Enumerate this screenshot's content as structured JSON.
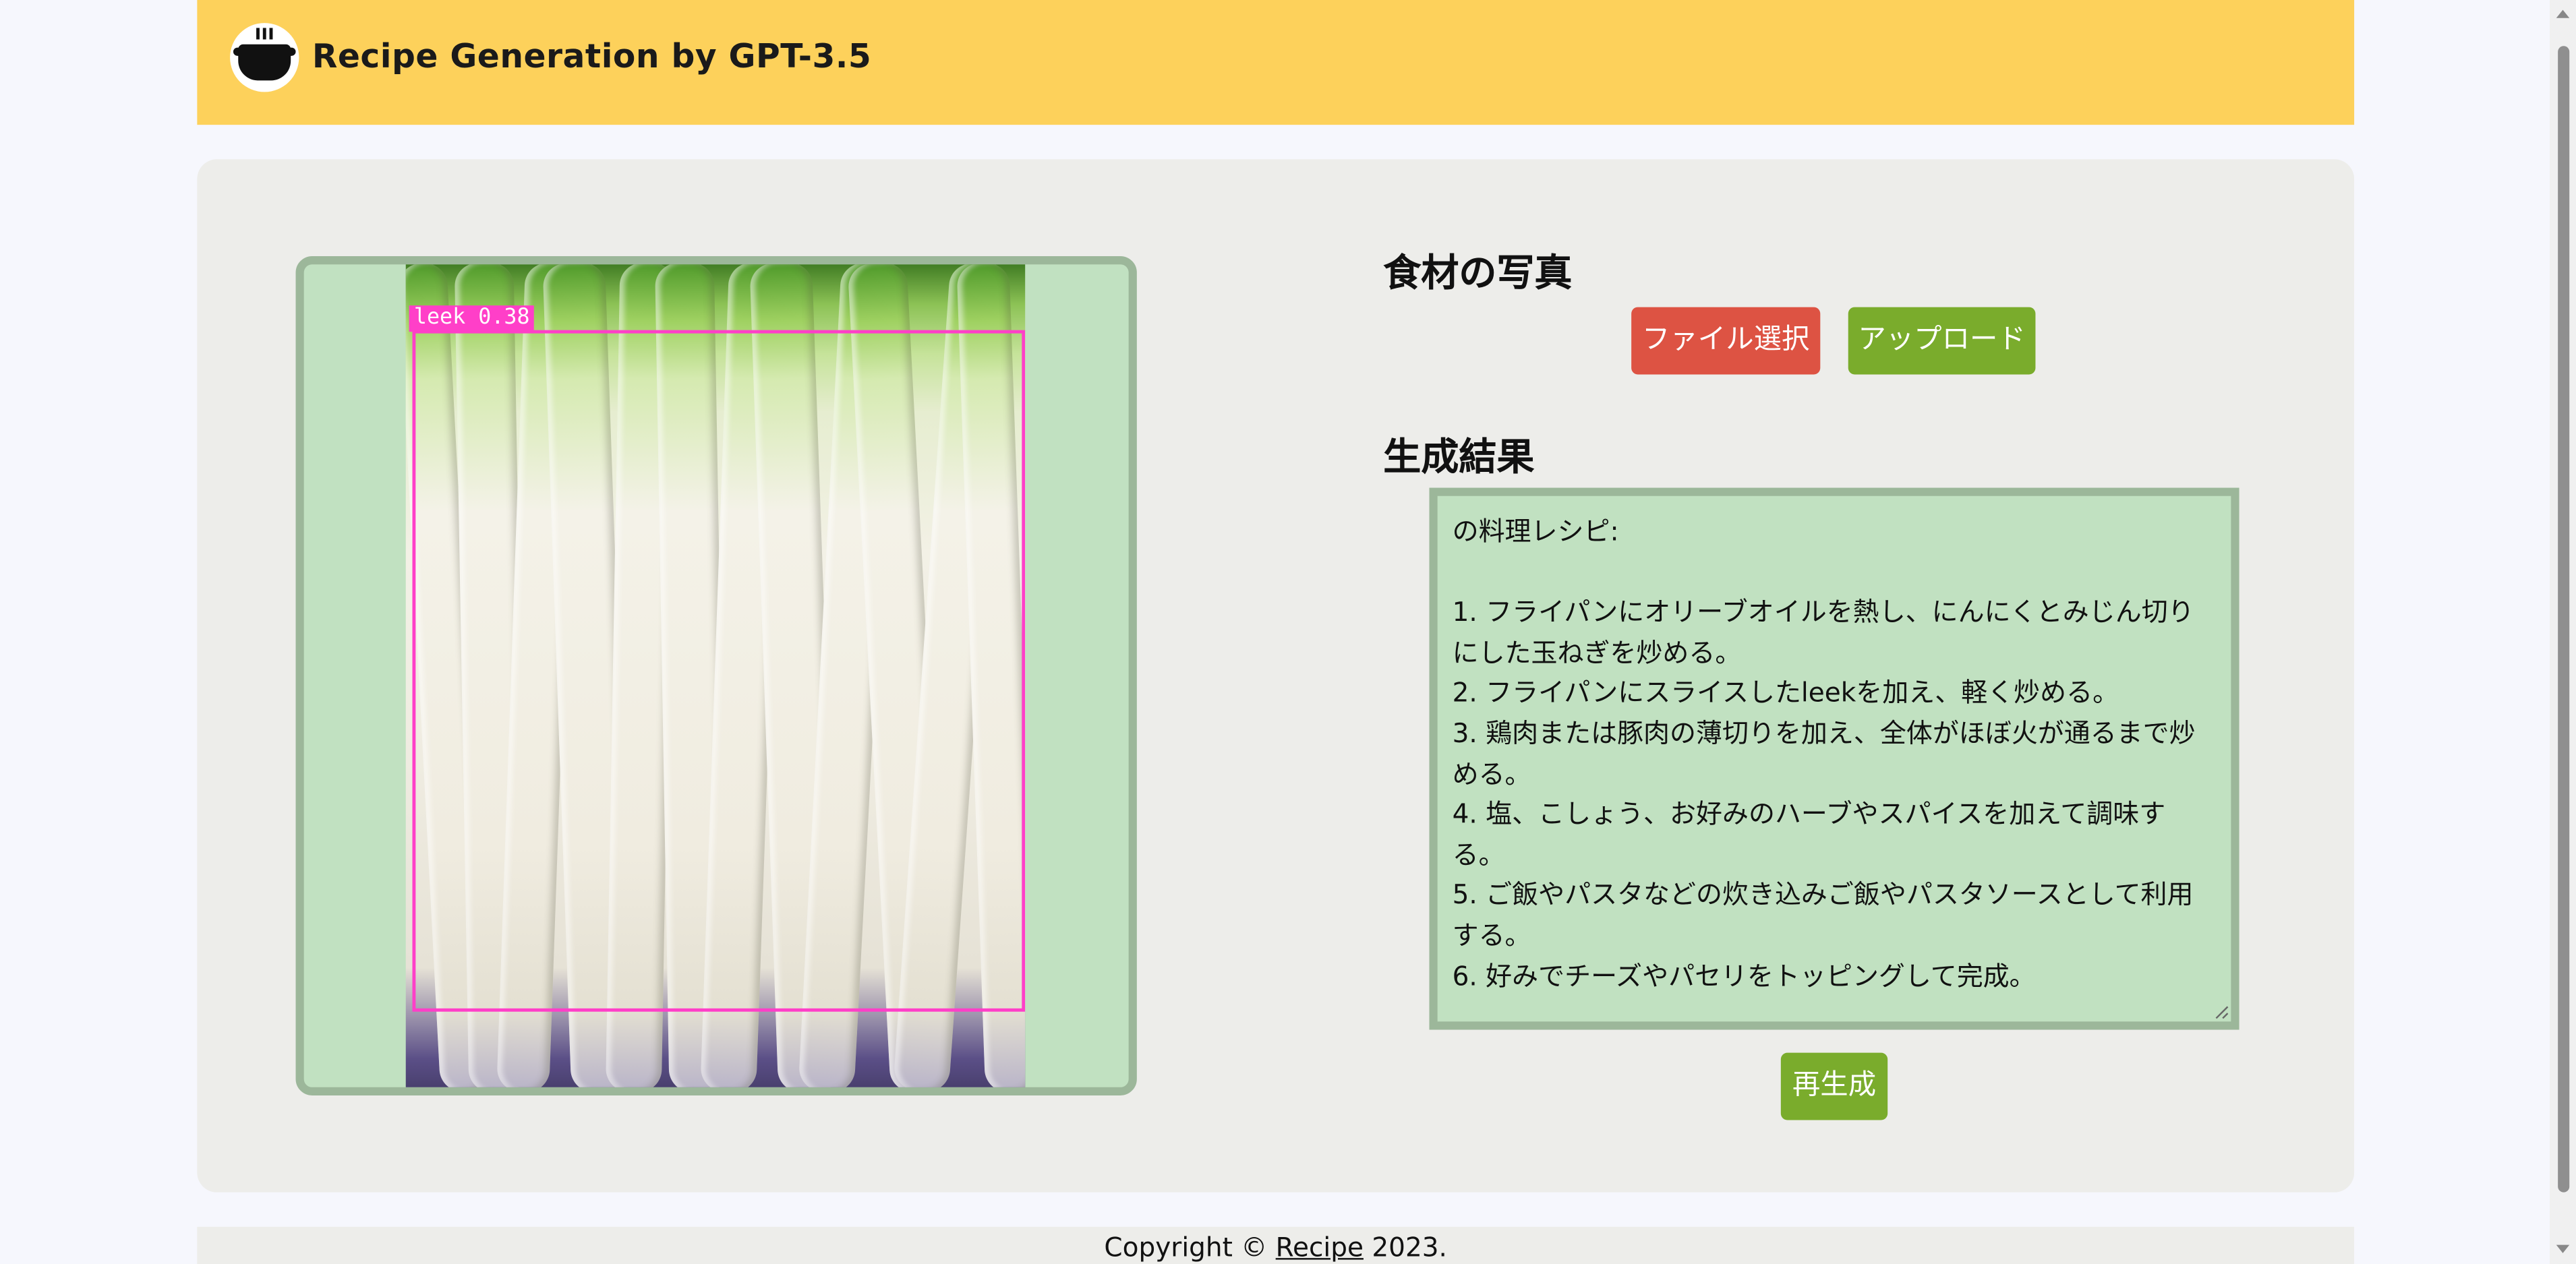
{
  "header": {
    "title": "Recipe Generation by GPT-3.5",
    "logo_icon": "cooking-pot-icon",
    "background": "#fdd15b"
  },
  "photo": {
    "detection_label": "leek  0.38",
    "box_color": "#ff3fc8",
    "frame_color": "#c1e1c1"
  },
  "upload_section": {
    "heading": "食材の写真",
    "file_select_label": "ファイル選択",
    "upload_label": "アップロード",
    "file_select_color": "#dd5343",
    "upload_color": "#7aac2c"
  },
  "result_section": {
    "heading": "生成結果",
    "text": "の料理レシピ:\n\n1. フライパンにオリーブオイルを熱し、にんにくとみじん切りにした玉ねぎを炒める。\n2. フライパンにスライスしたleekを加え、軽く炒める。\n3. 鶏肉または豚肉の薄切りを加え、全体がほぼ火が通るまで炒める。\n4. 塩、こしょう、お好みのハーブやスパイスを加えて調味する。\n5. ご飯やパスタなどの炊き込みご飯やパスタソースとして利用する。\n6. 好みでチーズやパセリをトッピングして完成。",
    "regenerate_label": "再生成"
  },
  "footer": {
    "prefix": "Copyright © ",
    "link_text": "Recipe",
    "suffix": " 2023."
  }
}
